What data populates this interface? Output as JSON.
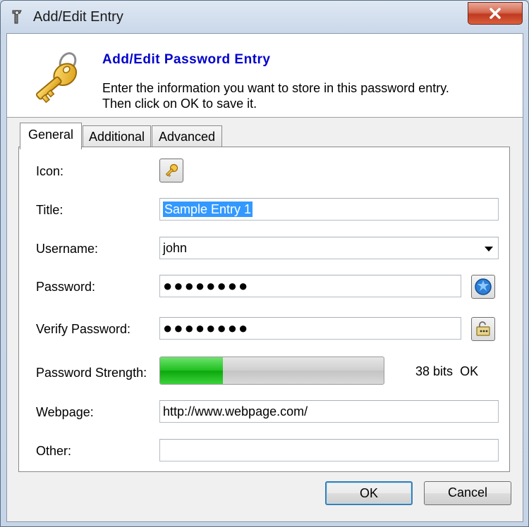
{
  "window": {
    "title": "Add/Edit Entry"
  },
  "banner": {
    "title": "Add/Edit Password Entry",
    "description_line1": "Enter the information you want to store in this password entry.",
    "description_line2": "Then click on OK to save it.",
    "icon": "key-icon"
  },
  "tabs": [
    {
      "label": "General",
      "active": true
    },
    {
      "label": "Additional",
      "active": false
    },
    {
      "label": "Advanced",
      "active": false
    }
  ],
  "form": {
    "icon_label": "Icon:",
    "title_label": "Title:",
    "title_value": "Sample Entry 1",
    "username_label": "Username:",
    "username_value": "john",
    "password_label": "Password:",
    "password_value": "●●●●●●●●",
    "verify_label": "Verify Password:",
    "verify_value": "●●●●●●●●",
    "strength_label": "Password Strength:",
    "strength_bits": "38 bits",
    "strength_status": "OK",
    "strength_fraction": 0.28,
    "webpage_label": "Webpage:",
    "webpage_value": "http://www.webpage.com/",
    "other_label": "Other:",
    "other_value": ""
  },
  "buttons": {
    "ok": "OK",
    "cancel": "Cancel"
  },
  "colors": {
    "banner_title": "#0000cc",
    "strength_fill": "#1fbf1f",
    "selection": "#3399ff",
    "close_button": "#c0391f"
  }
}
